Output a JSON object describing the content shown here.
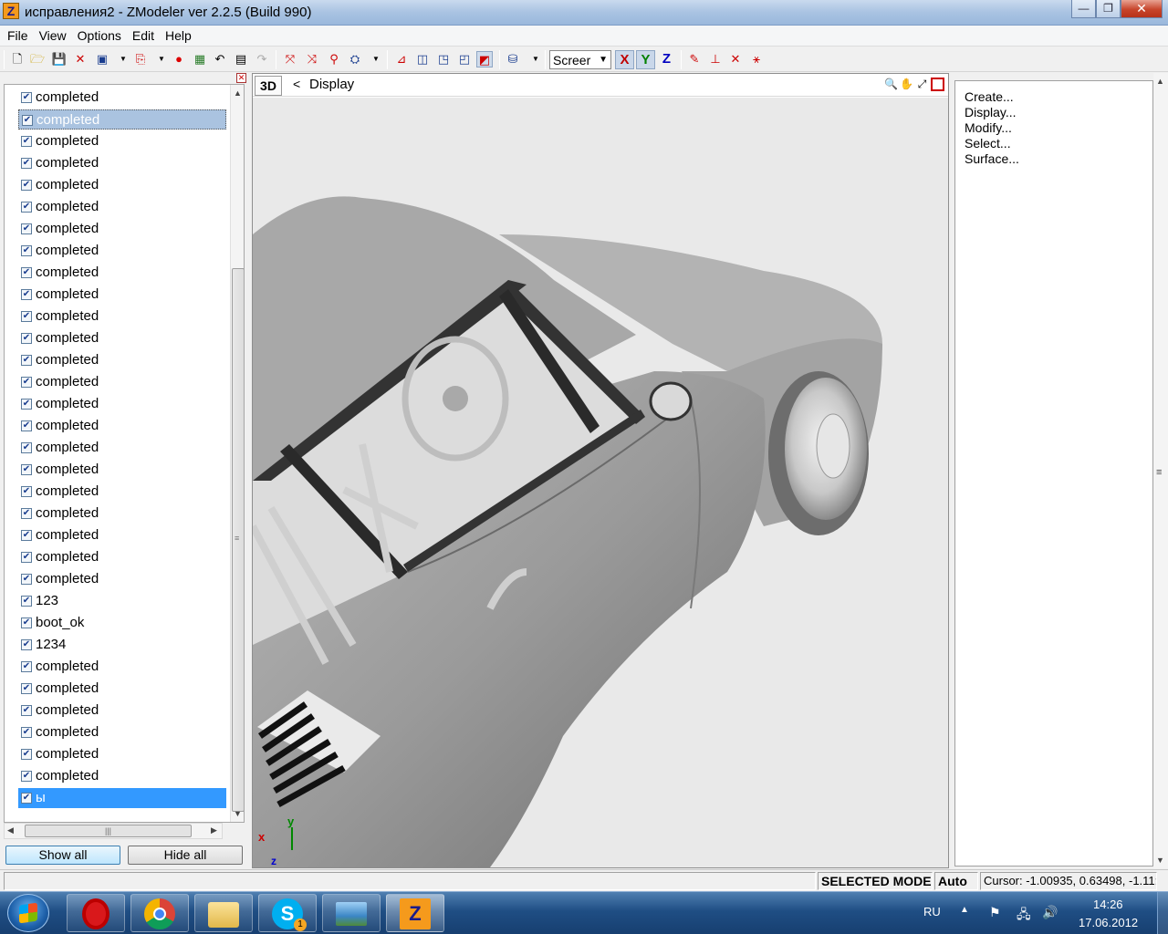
{
  "window": {
    "title": "исправления2 - ZModeler ver 2.2.5 (Build 990)",
    "app_icon_letter": "Z",
    "minimize": "—",
    "maximize": "❐",
    "close": "✕"
  },
  "menu": [
    "File",
    "View",
    "Options",
    "Edit",
    "Help"
  ],
  "toolbar": {
    "view_select": "Screer",
    "axis_x": "X",
    "axis_y": "Y",
    "axis_z": "Z"
  },
  "tree": {
    "items": [
      {
        "label": "completed",
        "checked": true,
        "state": "normal"
      },
      {
        "label": "completed",
        "checked": true,
        "state": "gray"
      },
      {
        "label": "completed",
        "checked": true,
        "state": "normal"
      },
      {
        "label": "completed",
        "checked": true,
        "state": "normal"
      },
      {
        "label": "completed",
        "checked": true,
        "state": "normal"
      },
      {
        "label": "completed",
        "checked": true,
        "state": "normal"
      },
      {
        "label": "completed",
        "checked": true,
        "state": "normal"
      },
      {
        "label": "completed",
        "checked": true,
        "state": "normal"
      },
      {
        "label": "completed",
        "checked": true,
        "state": "normal"
      },
      {
        "label": "completed",
        "checked": true,
        "state": "normal"
      },
      {
        "label": "completed",
        "checked": true,
        "state": "normal"
      },
      {
        "label": "completed",
        "checked": true,
        "state": "normal"
      },
      {
        "label": "completed",
        "checked": true,
        "state": "normal"
      },
      {
        "label": "completed",
        "checked": true,
        "state": "normal"
      },
      {
        "label": "completed",
        "checked": true,
        "state": "normal"
      },
      {
        "label": "completed",
        "checked": true,
        "state": "normal"
      },
      {
        "label": "completed",
        "checked": true,
        "state": "normal"
      },
      {
        "label": "completed",
        "checked": true,
        "state": "normal"
      },
      {
        "label": "completed",
        "checked": true,
        "state": "normal"
      },
      {
        "label": "completed",
        "checked": true,
        "state": "normal"
      },
      {
        "label": "completed",
        "checked": true,
        "state": "normal"
      },
      {
        "label": "completed",
        "checked": true,
        "state": "normal"
      },
      {
        "label": "completed",
        "checked": true,
        "state": "normal"
      },
      {
        "label": "123",
        "checked": true,
        "state": "normal"
      },
      {
        "label": "boot_ok",
        "checked": true,
        "state": "normal"
      },
      {
        "label": "1234",
        "checked": true,
        "state": "normal"
      },
      {
        "label": "completed",
        "checked": true,
        "state": "normal"
      },
      {
        "label": "completed",
        "checked": true,
        "state": "normal"
      },
      {
        "label": "completed",
        "checked": true,
        "state": "normal"
      },
      {
        "label": "completed",
        "checked": true,
        "state": "normal"
      },
      {
        "label": "completed",
        "checked": true,
        "state": "normal"
      },
      {
        "label": "completed",
        "checked": true,
        "state": "normal"
      },
      {
        "label": "ы",
        "checked": true,
        "state": "blue"
      }
    ],
    "show_all": "Show all",
    "hide_all": "Hide all"
  },
  "viewport": {
    "mode_label": "3D",
    "back_glyph": "<",
    "title": "Display",
    "gizmo_x": "x",
    "gizmo_y": "y",
    "gizmo_z": "z"
  },
  "right_panel": {
    "items": [
      "Create...",
      "Display...",
      "Modify...",
      "Select...",
      "Surface..."
    ]
  },
  "status": {
    "mode": "SELECTED MODE",
    "auto": "Auto",
    "cursor": "Cursor: -1.00935, 0.63498, -1.11:"
  },
  "taskbar": {
    "apps": [
      "opera-icon",
      "chrome-icon",
      "explorer-icon",
      "skype-icon",
      "photo-viewer-icon",
      "zmodeler-icon"
    ],
    "skype_badge": "1",
    "zmodeler_letter": "Z",
    "language": "RU",
    "time": "14:26",
    "date": "17.06.2012"
  },
  "colors": {
    "selection_blue": "#3399ff",
    "selection_gray": "#aac3e0",
    "axis_x": "#c00000",
    "axis_y": "#008000",
    "axis_z": "#0000c0"
  }
}
